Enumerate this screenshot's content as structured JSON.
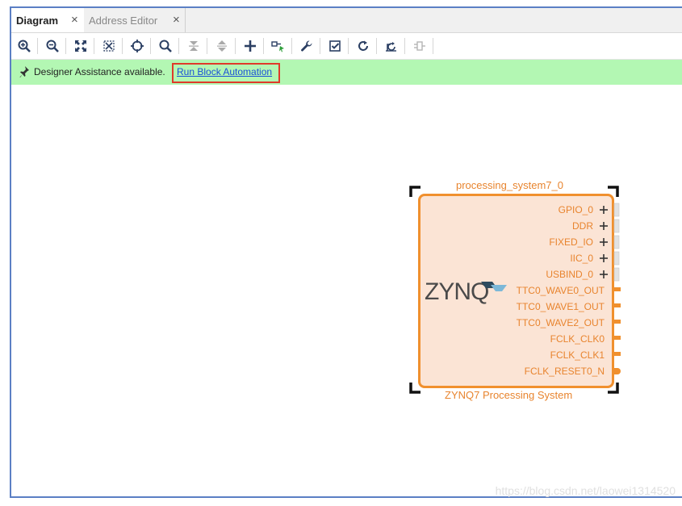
{
  "tabs": [
    {
      "label": "Diagram",
      "close": "×",
      "active": true
    },
    {
      "label": "Address Editor",
      "close": "×",
      "active": false
    }
  ],
  "toolbar": {
    "icons": [
      "zoom-in-icon",
      "zoom-out-icon",
      "zoom-fit-icon",
      "zoom-selection-icon",
      "center-icon",
      "search-icon",
      "collapse-all-icon",
      "expand-all-icon",
      "add-ip-icon",
      "make-connection-icon",
      "properties-wrench-icon",
      "validate-design-icon",
      "regenerate-layout-icon",
      "optimize-routing-icon",
      "ports-icon"
    ]
  },
  "assistance": {
    "message": "Designer Assistance available.",
    "link": "Run Block Automation"
  },
  "block": {
    "instance_name": "processing_system7_0",
    "subtitle": "ZYNQ7 Processing System",
    "logo": "ZYNQ",
    "interface_ports": [
      "GPIO_0",
      "DDR",
      "FIXED_IO",
      "IIC_0",
      "USBIND_0"
    ],
    "output_ports": [
      "TTC0_WAVE0_OUT",
      "TTC0_WAVE1_OUT",
      "TTC0_WAVE2_OUT",
      "FCLK_CLK0",
      "FCLK_CLK1",
      "FCLK_RESET0_N"
    ]
  },
  "colors": {
    "accent": "#f0902e",
    "block_fill": "#fbe4d5",
    "assist_bg": "#b3f7b3",
    "link": "#1a4fd8",
    "highlight": "#e03a2a"
  },
  "watermark": "https://blog.csdn.net/laowei1314520"
}
